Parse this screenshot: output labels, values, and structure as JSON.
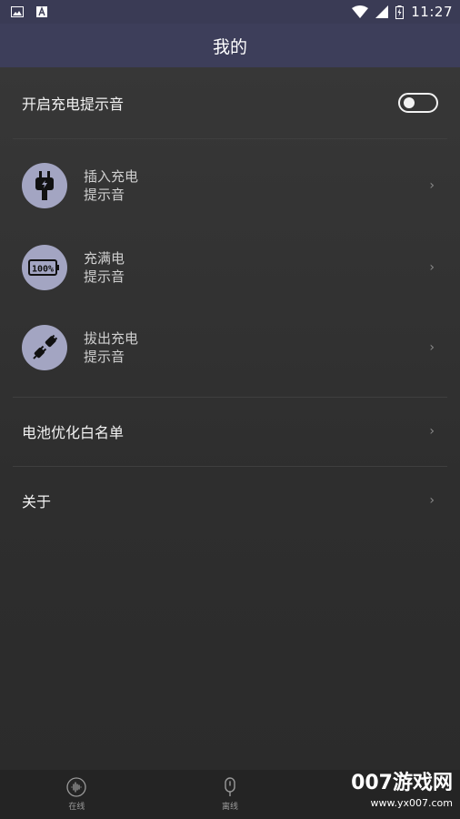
{
  "status_bar": {
    "time": "11:27",
    "icons": [
      "image-icon",
      "font-icon",
      "wifi-icon",
      "signal-icon",
      "battery-charging-icon"
    ]
  },
  "header": {
    "title": "我的"
  },
  "toggle_row": {
    "label": "开启充电提示音",
    "enabled": false
  },
  "sound_items": [
    {
      "line1": "插入充电",
      "line2": "提示音",
      "icon": "plug-icon"
    },
    {
      "line1": "充满电",
      "line2": "提示音",
      "icon": "battery-full-icon",
      "icon_text": "100%"
    },
    {
      "line1": "拔出充电",
      "line2": "提示音",
      "icon": "unplug-icon"
    }
  ],
  "menu": {
    "whitelist": "电池优化白名单",
    "about": "关于"
  },
  "bottom_tabs": [
    {
      "label": "在线",
      "icon": "sound-wave-icon"
    },
    {
      "label": "离线",
      "icon": "microphone-icon"
    }
  ],
  "watermark": {
    "brand": "007游戏网",
    "url": "www.yx007.com"
  },
  "colors": {
    "appbar": "#3d3e5a",
    "background": "#2f2f2f",
    "icon_circle": "#a3a5c2"
  }
}
